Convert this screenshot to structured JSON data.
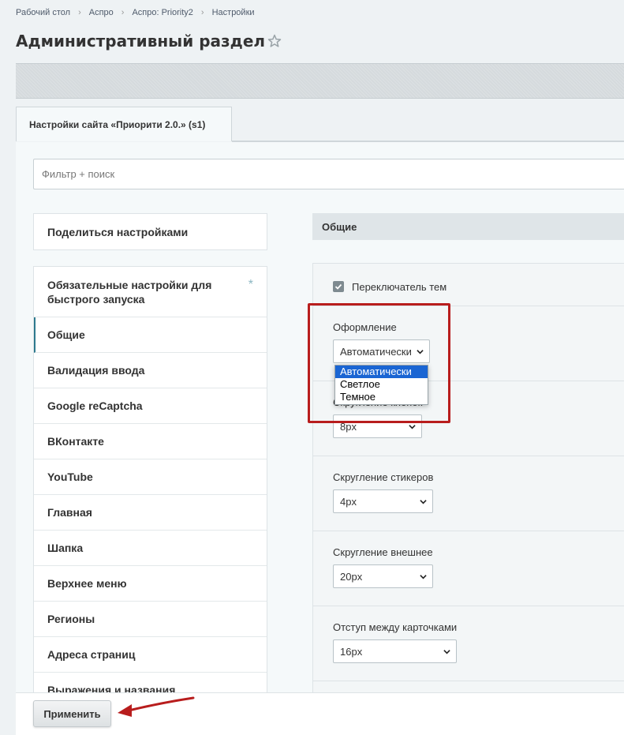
{
  "breadcrumb": [
    "Рабочий стол",
    "Аспро",
    "Аспро: Priority2",
    "Настройки"
  ],
  "page_title": "Административный раздел",
  "tab_label": "Настройки сайта «Приорити 2.0.» (s1)",
  "filter_placeholder": "Фильтр + поиск",
  "share_label": "Поделиться настройками",
  "nav": {
    "first": "Обязательные настройки для быстрого запуска",
    "first_mark": "*",
    "items": [
      "Общие",
      "Валидация ввода",
      "Google reCaptcha",
      "ВКонтакте",
      "YouTube",
      "Главная",
      "Шапка",
      "Верхнее меню",
      "Регионы",
      "Адреса страниц",
      "Выражения и названия"
    ]
  },
  "section_title": "Общие",
  "form": {
    "theme_switch_label": "Переключатель тем",
    "theme_switch_checked": true,
    "design_label": "Оформление",
    "design_value": "Автоматически",
    "button_rounding_label": "Скругление кнопок",
    "button_rounding_value": "8px",
    "sticker_rounding_label": "Скругление стикеров",
    "sticker_rounding_value": "4px",
    "outer_rounding_label": "Скругление внешнее",
    "outer_rounding_value": "20px",
    "card_gap_label": "Отступ между карточками",
    "card_gap_value": "16px"
  },
  "dropdown_options": [
    "Автоматически",
    "Светлое",
    "Темное"
  ],
  "dropdown_selected": "Автоматически",
  "apply_label": "Применить",
  "colors": {
    "accent": "#2d7a8e",
    "highlight": "#b81d1d",
    "selected_option": "#1a65d3"
  }
}
